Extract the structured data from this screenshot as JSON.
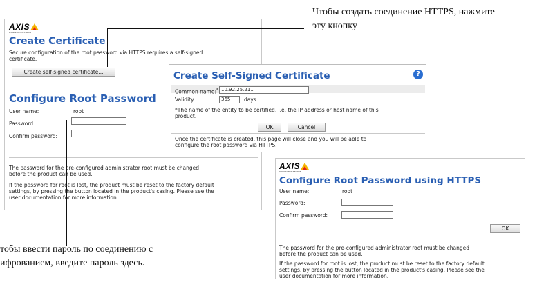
{
  "callouts": {
    "top": [
      "Чтобы создать соединение HTTPS, нажмите",
      "эту кнопку"
    ],
    "bottom": [
      "тобы ввести пароль по соединению с",
      "ифрованием, введите пароль здесь."
    ]
  },
  "left_panel": {
    "logo": "AXIS",
    "logo_sub": "COMMUNICATIONS",
    "create_cert_title": "Create Certificate",
    "create_cert_desc_line1": "Secure configuration of the root password via HTTPS requires a self-signed",
    "create_cert_desc_line2": "certificate.",
    "create_button": "Create self-signed certificate...",
    "configure_title": "Configure Root Password",
    "user_name_label": "User name:",
    "user_name_value": "root",
    "password_label": "Password:",
    "confirm_label": "Confirm password:",
    "note1_line1": "The password for the pre-configured administrator root must be changed",
    "note1_line2": "before the product can be used.",
    "note2_line1": "If the password for root is lost, the product must be reset to the factory default",
    "note2_line2": "settings, by pressing the button located in the product's casing. Please see the",
    "note2_line3": "user documentation for more information."
  },
  "dialog": {
    "title": "Create Self-Signed Certificate",
    "help_icon": "?",
    "common_name_label": "Common name:",
    "required_mark": "*",
    "common_name_value": "10.92.25.211",
    "validity_label": "Validity:",
    "validity_value": "365",
    "validity_unit": "days",
    "footnote_line1": "*The name of the entity to be certified, i.e. the IP address or host name of this",
    "footnote_line2": "product.",
    "ok_button": "OK",
    "cancel_button": "Cancel",
    "info_line1": "Once the certificate is created, this page will close and you will be able to",
    "info_line2": "configure the root password via HTTPS."
  },
  "https_panel": {
    "logo": "AXIS",
    "logo_sub": "COMMUNICATIONS",
    "title": "Configure Root Password using HTTPS",
    "user_name_label": "User name:",
    "user_name_value": "root",
    "password_label": "Password:",
    "confirm_label": "Confirm password:",
    "ok_button": "OK",
    "note1_line1": "The password for the pre-configured administrator root must be changed",
    "note1_line2": "before the product can be used.",
    "note2_line1": "If the password for root is lost, the product must be reset to the factory default",
    "note2_line2": "settings, by pressing the button located in the product's casing. Please see the",
    "note2_line3": "user documentation for more information."
  }
}
